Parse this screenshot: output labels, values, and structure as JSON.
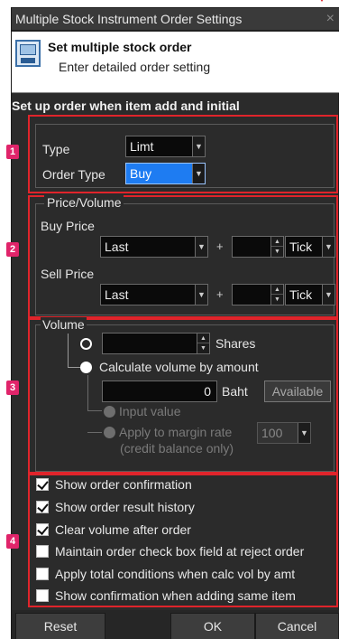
{
  "window": {
    "title": "Multiple Stock Instrument Order Settings",
    "close_glyph": "×"
  },
  "header": {
    "icon": "order-settings-icon",
    "title": "Set multiple stock order",
    "subtitle": "Enter detailed order setting"
  },
  "setup_label": "Set up order when item add and initial",
  "badges": [
    "1",
    "2",
    "3",
    "4"
  ],
  "section1": {
    "type_label": "Type",
    "type_value": "Limt",
    "order_type_label": "Order Type",
    "order_type_value": "Buy"
  },
  "price_volume": {
    "title": "Price/Volume",
    "buy_price_label": "Buy Price",
    "buy_price_value": "Last",
    "buy_tick_value": "Tick",
    "sell_price_label": "Sell Price",
    "sell_price_value": "Last",
    "sell_tick_value": "Tick",
    "plus": "+"
  },
  "volume": {
    "label": "Volume",
    "shares_label": "Shares",
    "calc_label": "Calculate volume by amount",
    "amount_value": "0",
    "baht_label": "Baht",
    "available_label": "Available",
    "input_value_label": "Input value",
    "margin_label_1": "Apply to margin rate",
    "margin_label_2": "(credit balance only)",
    "margin_value": "100"
  },
  "checkboxes": [
    {
      "label": "Show order confirmation",
      "checked": true
    },
    {
      "label": "Show order result history",
      "checked": true
    },
    {
      "label": "Clear volume after order",
      "checked": true
    },
    {
      "label": "Maintain order check box field at reject order",
      "checked": false
    },
    {
      "label": "Apply total conditions when calc vol by amt",
      "checked": false
    },
    {
      "label": "Show confirmation when adding same item",
      "checked": false
    }
  ],
  "footer": {
    "reset": "Reset",
    "ok": "OK",
    "cancel": "Cancel"
  },
  "colors": {
    "highlight_red": "#e0242b",
    "badge_pink": "#e0246a",
    "buy_blue": "#1e7cf2"
  }
}
